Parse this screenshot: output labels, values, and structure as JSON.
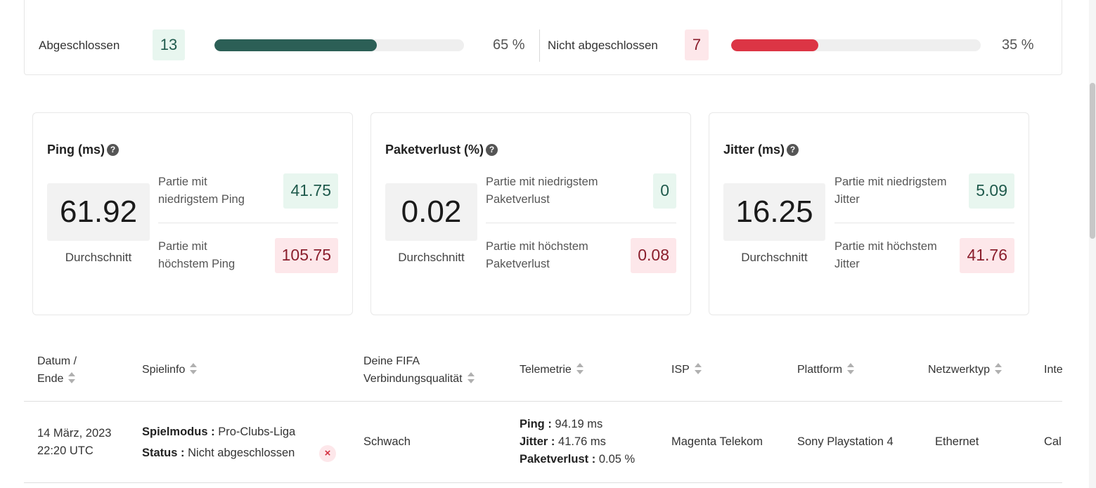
{
  "summary": {
    "completed_label": "Abgeschlossen",
    "completed_count": "13",
    "completed_pct_text": "65 %",
    "completed_fraction": 0.65,
    "incomplete_label": "Nicht abgeschlossen",
    "incomplete_count": "7",
    "incomplete_pct_text": "35 %",
    "incomplete_fraction": 0.35,
    "colors": {
      "completed": "#2c5f56",
      "incomplete": "#dc3545"
    }
  },
  "metrics": [
    {
      "title": "Ping (ms)",
      "average": "61.92",
      "average_label": "Durchschnitt",
      "min_label": "Partie mit niedrigstem Ping",
      "min_value": "41.75",
      "max_label": "Partie mit höchstem Ping",
      "max_value": "105.75"
    },
    {
      "title": "Paketverlust (%)",
      "average": "0.02",
      "average_label": "Durchschnitt",
      "min_label": "Partie mit niedrigstem Paketverlust",
      "min_value": "0",
      "max_label": "Partie mit höchstem Paketverlust",
      "max_value": "0.08"
    },
    {
      "title": "Jitter (ms)",
      "average": "16.25",
      "average_label": "Durchschnitt",
      "min_label": "Partie mit niedrigstem Jitter",
      "min_value": "5.09",
      "max_label": "Partie mit höchstem Jitter",
      "max_value": "41.76"
    }
  ],
  "help_glyph": "?",
  "table": {
    "headers": {
      "date_line1": "Datum /",
      "date_line2": "Ende",
      "gameinfo": "Spielinfo",
      "quality_line1": "Deine FIFA",
      "quality_line2": "Verbindungsqualität",
      "telemetry": "Telemetrie",
      "isp": "ISP",
      "platform": "Plattform",
      "network": "Netzwerktyp",
      "internet": "Inte"
    },
    "rows": [
      {
        "date": "14 März, 2023",
        "time": "22:20 UTC",
        "mode_label": "Spielmodus :",
        "mode_value": "Pro-Clubs-Liga",
        "status_label": "Status :",
        "status_value": "Nicht abgeschlossen",
        "status_icon": "×",
        "quality": "Schwach",
        "ping_label": "Ping :",
        "ping_value": "94.19 ms",
        "jitter_label": "Jitter :",
        "jitter_value": "41.76 ms",
        "loss_label": "Paketverlust :",
        "loss_value": "0.05 %",
        "isp": "Magenta Telekom",
        "platform": "Sony Playstation 4",
        "network": "Ethernet",
        "internet": "Cal"
      }
    ]
  }
}
